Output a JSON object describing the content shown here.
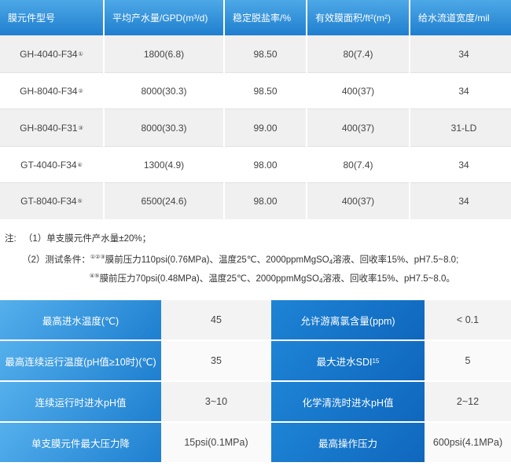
{
  "spec_table": {
    "headers": [
      "膜元件型号",
      "平均产水量/GPD(m³/d)",
      "稳定脱盐率/%",
      "有效膜面积/ft²(m²)",
      "给水流道宽度/mil"
    ],
    "rows": [
      {
        "model": "GH-4040-F34",
        "mark": "①",
        "flow": "1800(6.8)",
        "rejection": "98.50",
        "area": "80(7.4)",
        "spacer": "34"
      },
      {
        "model": "GH-8040-F34",
        "mark": "②",
        "flow": "8000(30.3)",
        "rejection": "98.50",
        "area": "400(37)",
        "spacer": "34"
      },
      {
        "model": "GH-8040-F31",
        "mark": "③",
        "flow": "8000(30.3)",
        "rejection": "99.00",
        "area": "400(37)",
        "spacer": "31-LD"
      },
      {
        "model": "GT-4040-F34",
        "mark": "④",
        "flow": "1300(4.9)",
        "rejection": "98.00",
        "area": "80(7.4)",
        "spacer": "34"
      },
      {
        "model": "GT-8040-F34",
        "mark": "⑤",
        "flow": "6500(24.6)",
        "rejection": "98.00",
        "area": "400(37)",
        "spacer": "34"
      }
    ]
  },
  "notes": {
    "prefix": "注:",
    "note1": "（1）单支膜元件产水量±20%；",
    "note2_label": "（2）测试条件：",
    "note2_marks": "①②③",
    "note2_text_a": "膜前压力110psi(0.76MPa)、温度25℃、2000ppmMgSO",
    "note2_sub": "4",
    "note2_text_b": "溶液、回收率15%、pH7.5~8.0;",
    "note3_marks": "④⑤",
    "note3_text_a": "膜前压力70psi(0.48MPa)、温度25℃、2000ppmMgSO",
    "note3_sub": "4",
    "note3_text_b": "溶液、回收率15%、pH7.5~8.0。"
  },
  "limits_table": {
    "rows": [
      {
        "label_left": "最高进水温度(℃)",
        "value_left": "45",
        "label_right": "允许游离氯含量(ppm)",
        "value_right": "< 0.1"
      },
      {
        "label_left": "最高连续运行温度(pH值≥10时)(℃)",
        "value_left": "35",
        "label_right": "最大进水SDI",
        "label_right_sub": "15",
        "value_right": "5"
      },
      {
        "label_left": "连续运行时进水pH值",
        "value_left": "3~10",
        "label_right": "化学清洗时进水pH值",
        "value_right": "2~12"
      },
      {
        "label_left": "单支膜元件最大压力降",
        "value_left": "15psi(0.1MPa)",
        "label_right": "最高操作压力",
        "value_right": "600psi(4.1MPa)"
      }
    ]
  },
  "colors": {
    "header_blue": "#2b8ad6",
    "label_blue": "#1e7fd0",
    "row_gray": "#f0f0f0"
  }
}
